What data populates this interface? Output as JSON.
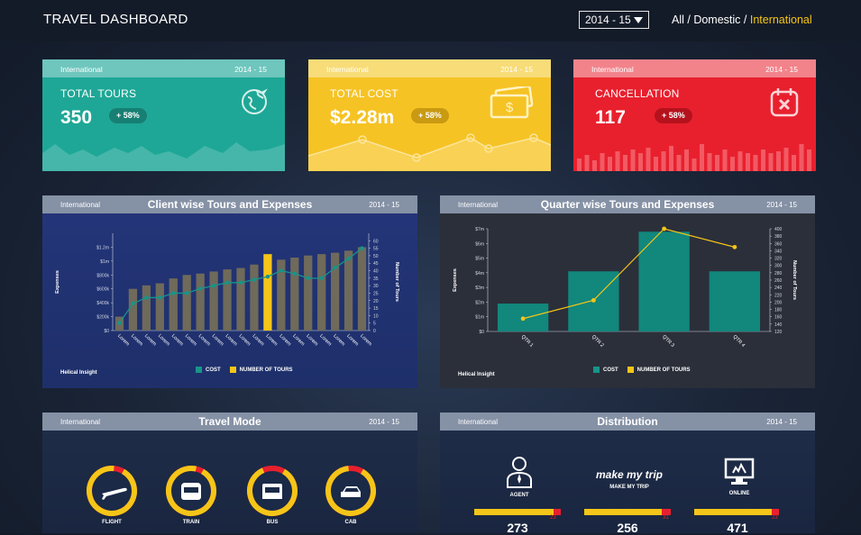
{
  "header": {
    "title": "TRAVEL DASHBOARD",
    "year": "2014 - 15",
    "nav_all": "All",
    "nav_sep1": " / ",
    "nav_domestic": "Domestic",
    "nav_sep2": " / ",
    "nav_international": "International"
  },
  "kpis": [
    {
      "tag": "International",
      "year": "2014 - 15",
      "label": "TOTAL TOURS",
      "value": "350",
      "change": "+ 58%",
      "color": "#1ea796",
      "header_color": "#6ec6bd",
      "icon": "globe-plane-icon"
    },
    {
      "tag": "International",
      "year": "2014 - 15",
      "label": "TOTAL COST",
      "value": "$2.28m",
      "change": "+ 58%",
      "color": "#f6c325",
      "header_color": "#f7dc78",
      "icon": "money-icon"
    },
    {
      "tag": "International",
      "year": "2014 - 15",
      "label": "CANCELLATION",
      "value": "117",
      "change": "+ 58%",
      "color": "#e8202e",
      "header_color": "#f2838b",
      "icon": "calendar-cancel-icon"
    }
  ],
  "client_panel": {
    "tag": "International",
    "title": "Client wise Tours and Expenses",
    "year": "2014 - 15",
    "brand": "Helical Insight",
    "legend_cost": "COST",
    "legend_tours": "NUMBER OF TOURS"
  },
  "quarter_panel": {
    "tag": "International",
    "title": "Quarter wise Tours and Expenses",
    "year": "2014 - 15",
    "brand": "Helical Insight",
    "legend_cost": "COST",
    "legend_tours": "NUMBER OF TOURS"
  },
  "mode_panel": {
    "tag": "International",
    "title": "Travel Mode",
    "year": "2014 - 15",
    "modes": [
      {
        "label": "FLIGHT",
        "icon": "flight-icon",
        "share": 0.93
      },
      {
        "label": "TRAIN",
        "icon": "train-icon",
        "share": 0.95
      },
      {
        "label": "BUS",
        "icon": "bus-icon",
        "share": 0.85
      },
      {
        "label": "CAB",
        "icon": "cab-icon",
        "share": 0.9
      }
    ]
  },
  "dist_panel": {
    "tag": "International",
    "title": "Distribution",
    "year": "2014 - 15",
    "items": [
      {
        "label": "AGENT",
        "value": "273",
        "cancel": "23",
        "icon": "agent-icon"
      },
      {
        "label": "MAKE MY TRIP",
        "value": "256",
        "cancel": "31",
        "icon": "makemytrip-logo",
        "logo_text": "make my trip"
      },
      {
        "label": "ONLINE",
        "value": "471",
        "cancel": "23",
        "icon": "online-icon"
      }
    ]
  },
  "chart_data": [
    {
      "type": "bar",
      "title": "Client wise Tours and Expenses",
      "categories": [
        "Lorem",
        "Lorem",
        "Lorem",
        "Lorem",
        "Lorem",
        "Lorem",
        "Lorem",
        "Lorem",
        "Lorem",
        "Lorem",
        "Lorem",
        "Lorem",
        "Lorem",
        "Lorem",
        "Lorem",
        "Lorem",
        "Lorem",
        "Lorem",
        "Lorem"
      ],
      "series": [
        {
          "name": "COST",
          "values": [
            200,
            600,
            650,
            680,
            750,
            800,
            820,
            850,
            880,
            900,
            950,
            1100,
            1020,
            1050,
            1080,
            1100,
            1120,
            1150,
            1200
          ]
        },
        {
          "name": "NUMBER OF TOURS",
          "values": [
            5,
            18,
            22,
            22,
            25,
            25,
            28,
            30,
            32,
            32,
            34,
            36,
            40,
            38,
            35,
            35,
            42,
            48,
            55
          ]
        }
      ],
      "highlight_index": 11,
      "ylabel": "Expenses",
      "y2label": "Number of Tours",
      "y_ticks": [
        "$0",
        "$200k",
        "$400k",
        "$600k",
        "$800k",
        "$1m",
        "$1.2m"
      ],
      "y2_ticks": [
        "0",
        "5",
        "10",
        "15",
        "20",
        "25",
        "30",
        "35",
        "40",
        "45",
        "50",
        "55",
        "60"
      ],
      "ylim": [
        0,
        1400
      ],
      "y2lim": [
        0,
        65
      ]
    },
    {
      "type": "bar",
      "title": "Quarter wise Tours and Expenses",
      "categories": [
        "QTR 1",
        "QTR 2",
        "QTR 3",
        "QTR 4"
      ],
      "series": [
        {
          "name": "COST",
          "values": [
            1.9,
            4.1,
            6.8,
            4.1
          ]
        },
        {
          "name": "NUMBER OF TOURS",
          "values": [
            155,
            205,
            400,
            350
          ]
        }
      ],
      "ylabel": "Expenses",
      "y2label": "Number of Tours",
      "y_ticks": [
        "$0",
        "$1m",
        "$2m",
        "$3m",
        "$4m",
        "$5m",
        "$6m",
        "$7m"
      ],
      "y2_ticks": [
        "120",
        "140",
        "160",
        "180",
        "200",
        "220",
        "240",
        "260",
        "280",
        "300",
        "320",
        "340",
        "360",
        "380",
        "400"
      ],
      "ylim": [
        0,
        7
      ],
      "y2lim": [
        120,
        400
      ]
    }
  ]
}
